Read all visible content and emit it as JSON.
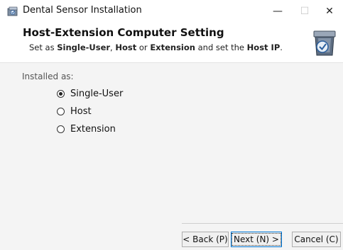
{
  "window": {
    "title": "Dental Sensor Installation",
    "controls": {
      "minimize": "—",
      "maximize": "☐",
      "close": "✕"
    }
  },
  "header": {
    "title": "Host-Extension Computer Setting",
    "subtitle": {
      "part1": "Set as ",
      "opt1": "Single-User",
      "part2": ", ",
      "opt2": "Host",
      "part3": " or ",
      "opt3": "Extension",
      "part4": " and set the ",
      "opt4": "Host IP",
      "part5": "."
    },
    "icon": "installer-box-icon"
  },
  "content": {
    "installed_label": "Installed as:",
    "options": [
      {
        "label": "Single-User",
        "checked": true
      },
      {
        "label": "Host",
        "checked": false
      },
      {
        "label": "Extension",
        "checked": false
      }
    ]
  },
  "buttons": {
    "back": "< Back (P)",
    "next": "Next (N) >",
    "cancel": "Cancel (C)"
  },
  "colors": {
    "content_bg": "#f4f4f4",
    "focus_border": "#0078d7"
  }
}
